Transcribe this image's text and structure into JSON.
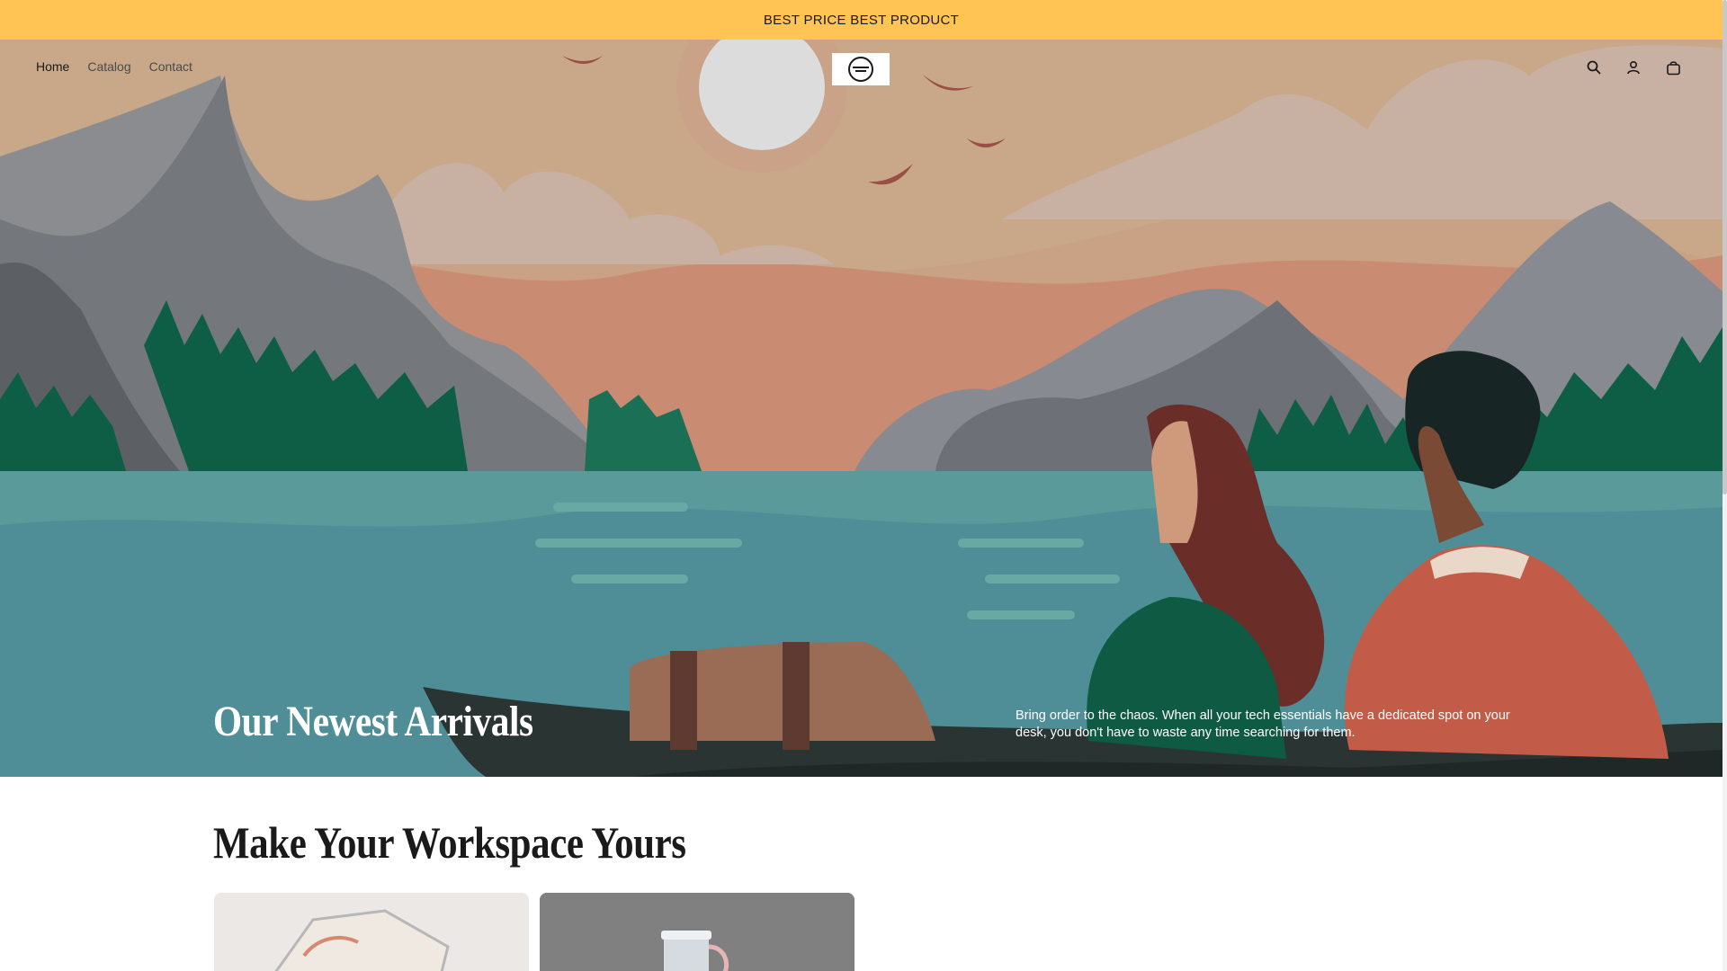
{
  "announcement": {
    "text": "BEST PRICE BEST PRODUCT"
  },
  "header": {
    "nav": [
      {
        "label": "Home",
        "active": true
      },
      {
        "label": "Catalog",
        "active": false
      },
      {
        "label": "Contact",
        "active": false
      }
    ],
    "icons": [
      "search-icon",
      "account-icon",
      "cart-icon"
    ]
  },
  "hero": {
    "heading": "Our Newest Arrivals",
    "text": "Bring order to the chaos. When all your tech essentials have a dedicated spot on your desk, you don't have to waste any time searching for them."
  },
  "collection": {
    "title": "Make Your Workspace Yours"
  },
  "colors": {
    "announcement_bg": "#ffc454",
    "sky": "#c9a184",
    "water": "#4f8e96",
    "forest": "#0d5e45"
  }
}
